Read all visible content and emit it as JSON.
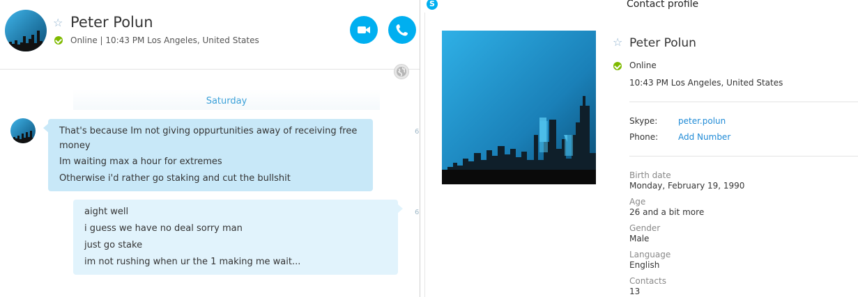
{
  "chat": {
    "contact_name": "Peter Polun",
    "status_line": "Online  |  10:43 PM Los Angeles, United States",
    "day_label": "Saturday",
    "incoming_messages": [
      "That's because Im not giving oppurtunities away of receiving free",
      "money",
      "Im waiting max a hour for extremes",
      "Otherwise i'd rather go staking and cut the bullshit"
    ],
    "outgoing_messages": [
      "aight well",
      "i guess we have no deal sorry man",
      "just go stake",
      "im not rushing when ur the 1 making me wait..."
    ],
    "time_marker_1": "6",
    "time_marker_2": "6"
  },
  "profile": {
    "window_title": "Contact profile",
    "skype_glyph": "S",
    "name": "Peter Polun",
    "status": "Online",
    "local_info": "10:43 PM Los Angeles, United States",
    "skype_label": "Skype:",
    "skype_id": "peter.polun",
    "phone_label": "Phone:",
    "phone_action": "Add Number",
    "details": [
      {
        "label": "Birth date",
        "value": "Monday, February 19, 1990"
      },
      {
        "label": "Age",
        "value": "26 and a bit more"
      },
      {
        "label": "Gender",
        "value": "Male"
      },
      {
        "label": "Language",
        "value": "English"
      },
      {
        "label": "Contacts",
        "value": "13"
      }
    ]
  },
  "icons": {
    "favorite": "star-icon",
    "status": "online-check-icon",
    "video": "video-camera-icon",
    "call": "phone-icon",
    "language": "globe-icon"
  },
  "colors": {
    "accent": "#00aff0",
    "online": "#7fba00",
    "link": "#1e8ad6",
    "incoming_bubble": "#c8e8f8",
    "outgoing_bubble": "#e1f3fc"
  }
}
